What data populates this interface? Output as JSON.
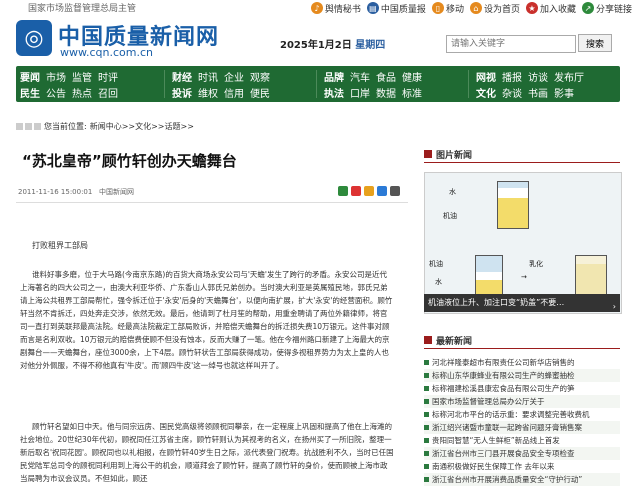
{
  "topbar": {
    "supervisor": "国家市场监督管理总局主管",
    "links": [
      {
        "label": "舆情秘书",
        "icon": "bell-icon"
      },
      {
        "label": "中国质量报",
        "icon": "newspaper-icon"
      },
      {
        "label": "移动",
        "icon": "mobile-icon"
      },
      {
        "label": "设为首页",
        "icon": "home-icon"
      },
      {
        "label": "加入收藏",
        "icon": "star-icon"
      },
      {
        "label": "分享链接",
        "icon": "share-icon"
      }
    ]
  },
  "header": {
    "site_name": "中国质量新闻网",
    "url": "www.cqn.com.cn",
    "date": "2025年1月2日",
    "weekday": "星期四",
    "search_placeholder": "请输入关键字",
    "search_button": "搜索"
  },
  "nav": {
    "groups": [
      {
        "rows": [
          {
            "head": "要闻",
            "items": [
              "市场",
              "监管",
              "时评"
            ]
          },
          {
            "head": "民生",
            "items": [
              "公告",
              "热点",
              "召回"
            ]
          }
        ]
      },
      {
        "rows": [
          {
            "head": "财经",
            "items": [
              "时讯",
              "企业",
              "观察"
            ]
          },
          {
            "head": "投诉",
            "items": [
              "维权",
              "信用",
              "便民"
            ]
          }
        ]
      },
      {
        "rows": [
          {
            "head": "品牌",
            "items": [
              "汽车",
              "食品",
              "健康"
            ]
          },
          {
            "head": "执法",
            "items": [
              "口岸",
              "数据",
              "标准"
            ]
          }
        ]
      },
      {
        "rows": [
          {
            "head": "网视",
            "items": [
              "播报",
              "访谈",
              "发布厅"
            ]
          },
          {
            "head": "文化",
            "items": [
              "杂谈",
              "书画",
              "影事"
            ]
          }
        ]
      }
    ]
  },
  "breadcrumb": {
    "prefix": "您当前位置:",
    "path": "新闻中心>>文化>>话题>>"
  },
  "article": {
    "title": "“苏北皇帝”顾竹轩创办天蟾舞台",
    "datetime": "2011-11-16 15:00:01",
    "source": "中国新闻网",
    "byline": "打败租界工部局",
    "para1": "谁料好事多磨，位于大马路(今南京东路)的百货大商场永安公司与'天蟾'发生了跨行的矛盾。永安公司是近代上海著名的四大公司之一，由澳大利亚华侨、广东香山人郭氏兄弟创办。当时澳大利亚是英属殖民地，郭氏兄弟请上海公共租界工部局帮忙，强令拆迁位于'永安'后身的'天蟾舞台'，以便向南扩展，扩大'永安'的经营面积。顾竹轩当然不肯拆迁，四处奔走交涉，依然无效。最后，他请到了杜月笙的帮助，用重金聘请了两位外籍律师，将官司一直打到英联邦最高法院。经最高法院裁定工部局败诉，并赔偿天蟾舞台的拆迁损失费10万银元。这件事对顾而言是名利双收。10万银元的赔偿费使顾不但没有蚀本，反而大赚了一笔。他在今福州路口新建了上海最大的京剧舞台——天蟾舞台，座位3000余，上下4层。顾竹轩状告工部局获得成功，使得多视租界势力为太上皇的人也对他分外佩服，不得不称他真有'牛皮'。而'顾四牛皮'这一绰号也就这样叫开了。",
    "para2": "顾竹轩名望如日中天。他与同宗远房、国民党高级将领顾祝同攀亲，在一定程度上巩固和提高了他在上海滩的社会地位。20世纪30年代初，顾祝同任江苏省主席，顾竹轩则认为其视考的名义，在扬州买了一所旧院，整理一新后取名'祝同花园'。顾祝同也以礼相报，在顾竹轩40岁生日之际，派代表登门祝寿。抗战胜利不久，当时已任国民党陆军总司令的顾祝同利用到上海公干的机会，顺道拜会了顾竹轩，提高了顾竹轩的身价，使而顾被上海市政当局聘为市议会议员。不但如此，顾还"
  },
  "sidebar": {
    "pic_section": "图片新闻",
    "pic_labels": {
      "water": "水",
      "oil": "机油",
      "milk": "乳化"
    },
    "pic_caption": "机油液位上升、加注口变“奶盖”不要…",
    "news_section": "最新新闻",
    "news": [
      "河北祥隆泰超市有限责任公司新华店销售的",
      "标称山东华康蜂业有限公司生产的蜂蜜抽检",
      "标称福建松溪县康宏食品有限公司生产的笋",
      "国家市场监督管理总局办公厅关于",
      "标称河北市平台的话示重：要求调整完善收费机",
      "浙江绍兴诸暨市童联一起跨省问题牙膏销售案",
      "贵阳同智慧“无人生鲜柜”新品线上首发",
      "浙江省台州市三门县开展食品安全专项检查",
      "南通积极做好民生保障工作 去年以来",
      "浙江省台州市开展消费品质量安全“守护行动”"
    ]
  },
  "colors": {
    "brand_blue": "#1a5fa8",
    "nav_green": "#1f6a33",
    "section_red": "#9b1c1c"
  }
}
